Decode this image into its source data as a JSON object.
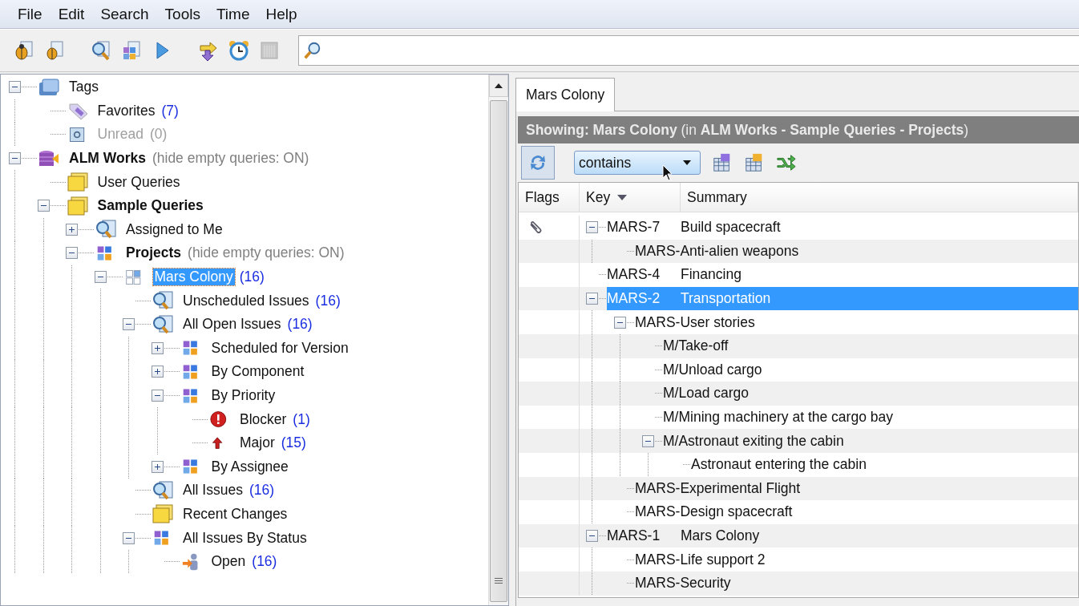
{
  "menu": [
    "File",
    "Edit",
    "Search",
    "Tools",
    "Time",
    "Help"
  ],
  "tree": [
    {
      "label": "Tags",
      "kind": "tag-folder",
      "expanded": true,
      "selected": false,
      "children": [
        {
          "label": "Favorites",
          "count": "(7)",
          "kind": "tag",
          "selected": false,
          "disabled": false
        },
        {
          "label": "Unread",
          "count": "(0)",
          "kind": "unread",
          "selected": false,
          "disabled": true
        }
      ]
    },
    {
      "label": "ALM Works",
      "bold": true,
      "note": "(hide empty queries: ON)",
      "kind": "database",
      "expanded": true,
      "selected": false,
      "children": [
        {
          "label": "User Queries",
          "kind": "folder",
          "selected": false
        },
        {
          "label": "Sample Queries",
          "bold": true,
          "kind": "folder",
          "expanded": true,
          "selected": false,
          "children": [
            {
              "label": "Assigned to Me",
              "kind": "query",
              "expanded": false,
              "selected": false
            },
            {
              "label": "Projects",
              "bold": true,
              "note": "(hide empty queries: ON)",
              "kind": "distribution",
              "expanded": true,
              "selected": false,
              "children": [
                {
                  "label": "Mars Colony",
                  "count": "(16)",
                  "kind": "distribution-empty",
                  "expanded": true,
                  "selected": true,
                  "children": [
                    {
                      "label": "Unscheduled Issues",
                      "count": "(16)",
                      "kind": "query",
                      "selected": false
                    },
                    {
                      "label": "All Open Issues",
                      "count": "(16)",
                      "kind": "query",
                      "expanded": true,
                      "selected": false,
                      "children": [
                        {
                          "label": "Scheduled for Version",
                          "kind": "distribution",
                          "expanded": false,
                          "selected": false
                        },
                        {
                          "label": "By Component",
                          "kind": "distribution",
                          "expanded": false,
                          "selected": false
                        },
                        {
                          "label": "By Priority",
                          "kind": "distribution",
                          "expanded": true,
                          "selected": false,
                          "children": [
                            {
                              "label": "Blocker",
                              "count": "(1)",
                              "kind": "blocker",
                              "selected": false
                            },
                            {
                              "label": "Major",
                              "count": "(15)",
                              "kind": "major",
                              "selected": false
                            }
                          ]
                        },
                        {
                          "label": "By Assignee",
                          "kind": "distribution",
                          "expanded": false,
                          "selected": false
                        }
                      ]
                    },
                    {
                      "label": "All Issues",
                      "count": "(16)",
                      "kind": "query",
                      "selected": false
                    },
                    {
                      "label": "Recent Changes",
                      "kind": "folder",
                      "selected": false
                    },
                    {
                      "label": "All Issues By Status",
                      "kind": "distribution",
                      "expanded": true,
                      "selected": false,
                      "children": [
                        {
                          "label": "Open",
                          "count": "(16)",
                          "kind": "person",
                          "selected": false
                        }
                      ]
                    }
                  ]
                }
              ]
            }
          ]
        }
      ]
    }
  ],
  "tabs": [
    {
      "label": "Mars Colony",
      "selected": true
    }
  ],
  "showing": "**Showing: Mars Colony** (in **ALM Works - Sample Queries - Projects**)",
  "filter": {
    "value": "contains"
  },
  "table": {
    "columns": [
      {
        "label": "Flags"
      },
      {
        "label": "Key",
        "sorted": true
      },
      {
        "label": "Summary"
      }
    ],
    "rows": [
      {
        "key": "MARS-7",
        "summary": "Build spacecraft",
        "attachment": true,
        "expanded": true,
        "selected": false,
        "children": [
          {
            "label": "MARS-Anti-alien weapons",
            "selected": false
          }
        ]
      },
      {
        "key": "MARS-4",
        "summary": "Financing",
        "attachment": false,
        "selected": false
      },
      {
        "key": "MARS-2",
        "summary": "Transportation",
        "attachment": false,
        "expanded": true,
        "selected": true,
        "children": [
          {
            "label": "MARS-User stories",
            "expanded": true,
            "selected": false,
            "children": [
              {
                "label": "M/Take-off",
                "selected": false
              },
              {
                "label": "M/Unload cargo",
                "selected": false
              },
              {
                "label": "M/Load cargo",
                "selected": false
              },
              {
                "label": "M/Mining machinery at the cargo bay",
                "selected": false
              },
              {
                "label": "M/Astronaut exiting the cabin",
                "expanded": true,
                "selected": false,
                "children": [
                  {
                    "label": "Astronaut entering the cabin",
                    "selected": false
                  }
                ]
              }
            ]
          },
          {
            "label": "MARS-Experimental Flight",
            "selected": false
          },
          {
            "label": "MARS-Design spacecraft",
            "selected": false
          }
        ]
      },
      {
        "key": "MARS-1",
        "summary": "Mars Colony",
        "attachment": false,
        "expanded": true,
        "selected": false,
        "children": [
          {
            "label": "MARS-Life support 2",
            "selected": false
          },
          {
            "label": "MARS-Security",
            "selected": false
          }
        ]
      }
    ]
  }
}
